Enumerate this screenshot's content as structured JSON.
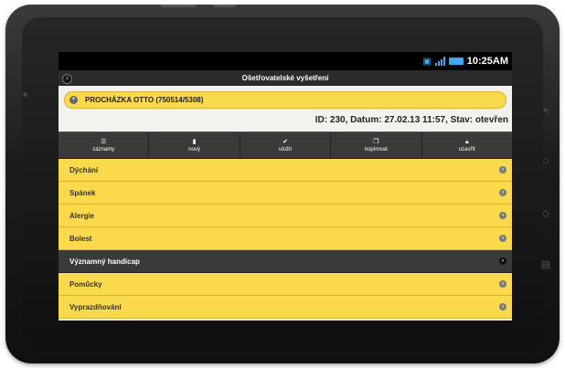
{
  "status_bar": {
    "time": "10:25AM",
    "icons": [
      "usb-icon",
      "signal-icon",
      "battery-icon"
    ]
  },
  "header": {
    "title": "Ošetřovatelské vyšetření",
    "home_icon": "home-icon"
  },
  "patient": {
    "name": "PROCHÁZKA OTTO (750514/5308)",
    "icon": "expand-icon"
  },
  "info_line": "ID: 230, Datum: 27.02.13 11:57, Stav: otevřen",
  "toolbar": [
    {
      "label": "záznamy",
      "icon": "list-icon"
    },
    {
      "label": "nový",
      "icon": "new-document-icon"
    },
    {
      "label": "uložit",
      "icon": "check-icon"
    },
    {
      "label": "kopírovat",
      "icon": "copy-icon"
    },
    {
      "label": "uzavřít",
      "icon": "lock-icon"
    }
  ],
  "items": [
    {
      "label": "Dýchání",
      "active": false
    },
    {
      "label": "Spánek",
      "active": false
    },
    {
      "label": "Alergie",
      "active": false
    },
    {
      "label": "Bolest",
      "active": false
    },
    {
      "label": "Významný handicap",
      "active": true
    },
    {
      "label": "Pomůcky",
      "active": false
    },
    {
      "label": "Vyprazdňování",
      "active": false
    }
  ],
  "colors": {
    "accent": "#fbd94c",
    "header": "#2b2b2b",
    "active_item": "#3a3a3a",
    "status_icons": "#3fa9f5"
  }
}
